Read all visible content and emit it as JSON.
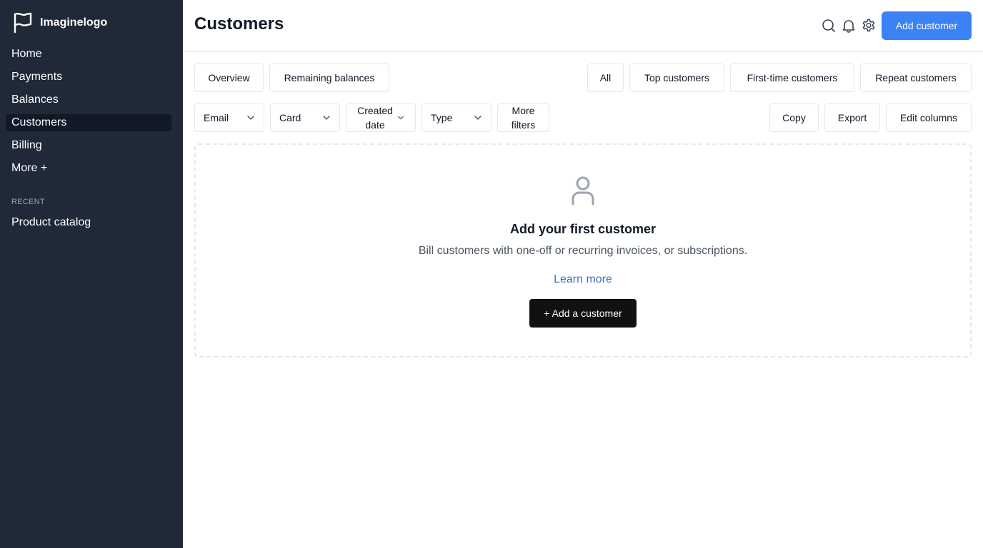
{
  "brand": {
    "name": "Imaginelogo",
    "icon": "flag-icon"
  },
  "sidebar": {
    "items": [
      {
        "label": "Home",
        "active": false
      },
      {
        "label": "Payments",
        "active": false
      },
      {
        "label": "Balances",
        "active": false
      },
      {
        "label": "Customers",
        "active": true
      },
      {
        "label": "Billing",
        "active": false
      },
      {
        "label": "More +",
        "active": false
      }
    ],
    "recent_label": "RECENT",
    "recent_items": [
      {
        "label": "Product catalog"
      }
    ]
  },
  "header": {
    "title": "Customers",
    "icons": [
      "search-icon",
      "bell-icon",
      "gear-icon"
    ],
    "add_button": "Add customer"
  },
  "tabs": {
    "overview": "Overview",
    "remaining_balances": "Remaining balances"
  },
  "segments": {
    "all": "All",
    "top": "Top customers",
    "first_time": "First-time customers",
    "repeat": "Repeat customers"
  },
  "filters": {
    "email": "Email",
    "card": "Card",
    "created_line1": "Created",
    "created_line2": "date",
    "type": "Type",
    "more_line1": "More",
    "more_line2": "filters"
  },
  "actions": {
    "copy": "Copy",
    "export": "Export",
    "edit_columns": "Edit columns"
  },
  "empty_state": {
    "icon": "user-icon",
    "title": "Add your first customer",
    "description": "Bill customers with one-off or recurring invoices, or subscriptions.",
    "learn_more": "Learn more",
    "button": "+ Add a customer"
  },
  "colors": {
    "sidebar_bg": "#1f2937",
    "active_item_bg": "#111827",
    "primary": "#3b82f6",
    "link": "#3b74c7",
    "dark_button": "#111111"
  }
}
